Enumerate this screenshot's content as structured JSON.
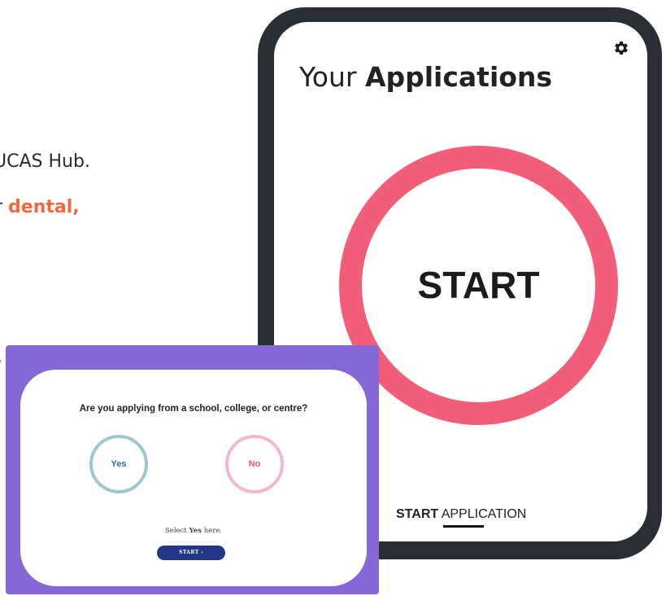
{
  "document": {
    "line1": "UCAS Hub.",
    "line2_prefix": "r ",
    "line2_accent": "dental,",
    "line3": "."
  },
  "phone_app": {
    "title_light": "Your ",
    "title_bold": "Applications",
    "settings_icon": "gear-icon",
    "start_button_label": "START",
    "bottom_tab_bold": "START",
    "bottom_tab_rest": " APPLICATION"
  },
  "embedded_screen": {
    "question": "Are you applying from a school, college, or centre?",
    "yes_label": "Yes",
    "no_label": "No",
    "hint_prefix": "Select ",
    "hint_bold": "Yes",
    "hint_suffix": " here.",
    "start_button_label": "START  ›"
  },
  "colors": {
    "start_ring": "#f25d79",
    "purple_frame": "#8567d6",
    "yes_ring": "#9fc7cf",
    "no_ring": "#f5b8c7",
    "small_start_button": "#233787",
    "accent_text": "#f2683f"
  }
}
